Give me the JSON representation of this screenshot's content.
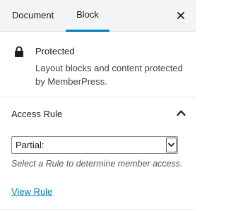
{
  "tabs": [
    {
      "label": "Document",
      "active": false
    },
    {
      "label": "Block",
      "active": true
    }
  ],
  "close_icon": "close-icon",
  "block_card": {
    "icon": "lock-icon",
    "title": "Protected",
    "description": "Layout blocks and content protected by MemberPress."
  },
  "access_panel": {
    "title": "Access Rule",
    "expanded": true,
    "select": {
      "value": "Partial:"
    },
    "help": "Select a Rule to determine member access.",
    "link": "View Rule"
  },
  "colors": {
    "accent": "#007cba",
    "topbar_bg": "#f3f4f5",
    "border": "#e2e4e7"
  }
}
